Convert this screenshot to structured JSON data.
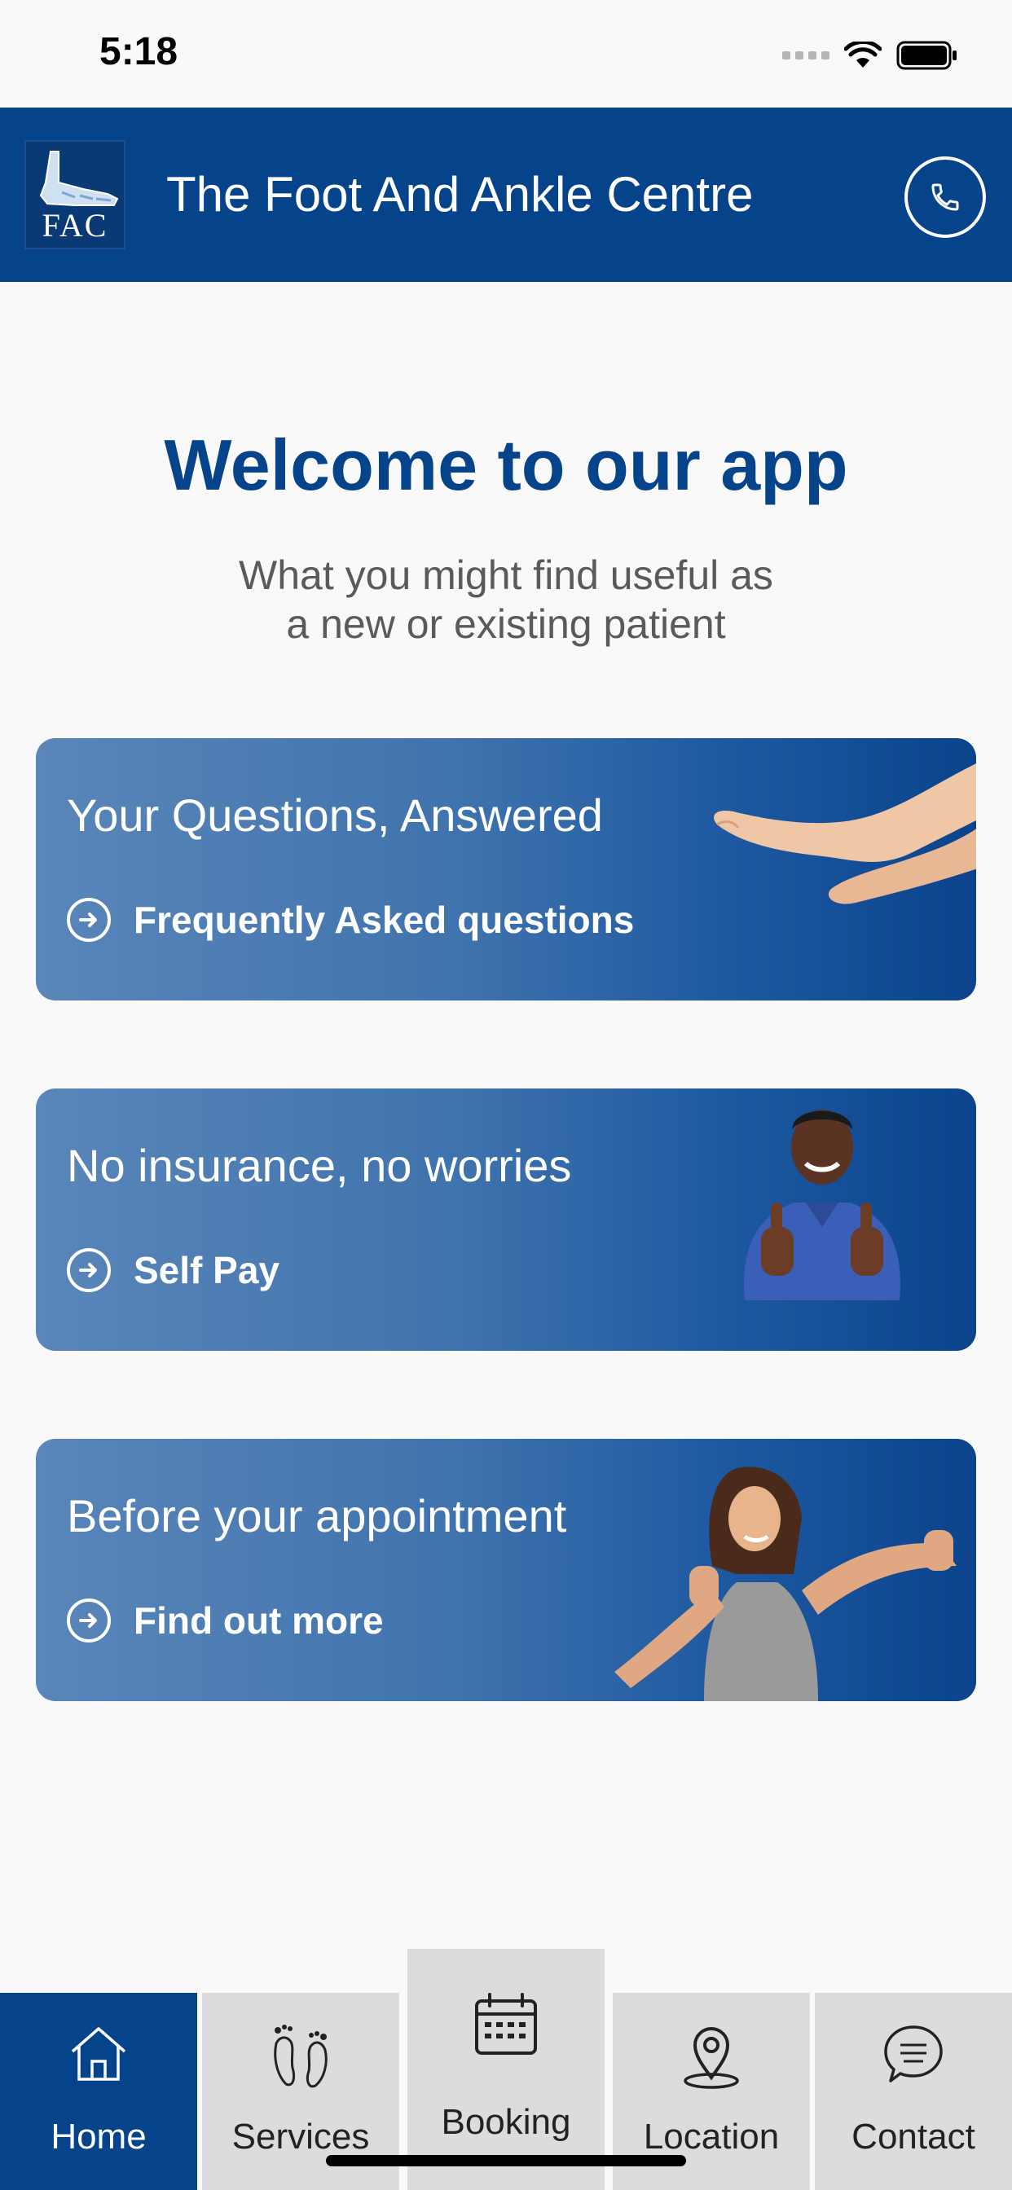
{
  "status_bar": {
    "time": "5:18"
  },
  "header": {
    "logo_text": "FAC",
    "title": "The Foot And Ankle Centre"
  },
  "welcome": {
    "title": "Welcome to our app",
    "subtitle_line1": "What you might find useful as",
    "subtitle_line2": "a new or existing patient"
  },
  "cards": [
    {
      "title": "Your Questions, Answered",
      "link": "Frequently Asked questions"
    },
    {
      "title": "No insurance, no worries",
      "link": "Self Pay"
    },
    {
      "title": "Before your appointment",
      "link": "Find out more"
    }
  ],
  "tabs": [
    {
      "label": "Home",
      "icon": "home-icon",
      "active": true
    },
    {
      "label": "Services",
      "icon": "feet-icon"
    },
    {
      "label": "Booking",
      "icon": "calendar-icon"
    },
    {
      "label": "Location",
      "icon": "location-pin-icon"
    },
    {
      "label": "Contact",
      "icon": "chat-icon"
    }
  ],
  "colors": {
    "brand": "#05438a",
    "tab_bg": "#dcdcdc",
    "background": "#f9f9f9"
  }
}
